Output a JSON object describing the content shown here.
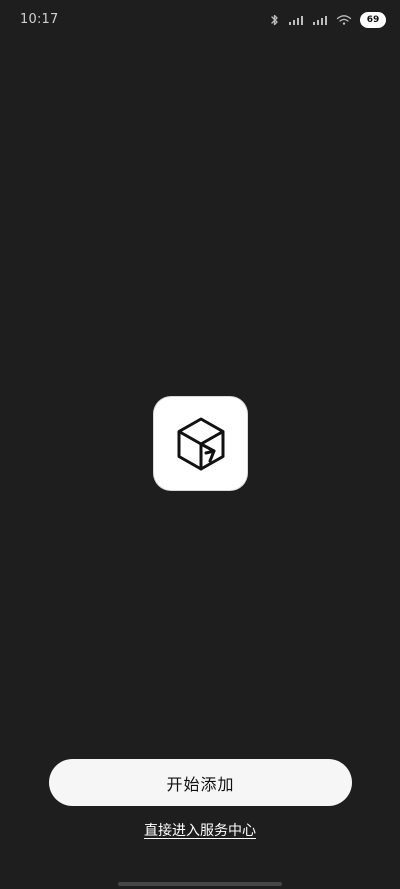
{
  "status_bar": {
    "time": "10:17",
    "battery_level": "69",
    "icons": [
      "bluetooth-icon",
      "signal-icon",
      "signal-icon",
      "wifi-icon",
      "battery-icon"
    ]
  },
  "app": {
    "logo_icon": "app-logo-icon"
  },
  "actions": {
    "primary_label": "开始添加",
    "secondary_link_label": "直接进入服务中心"
  },
  "theme": {
    "background": "#1e1e1e",
    "button_bg": "#f6f6f6",
    "button_text": "#111111"
  }
}
